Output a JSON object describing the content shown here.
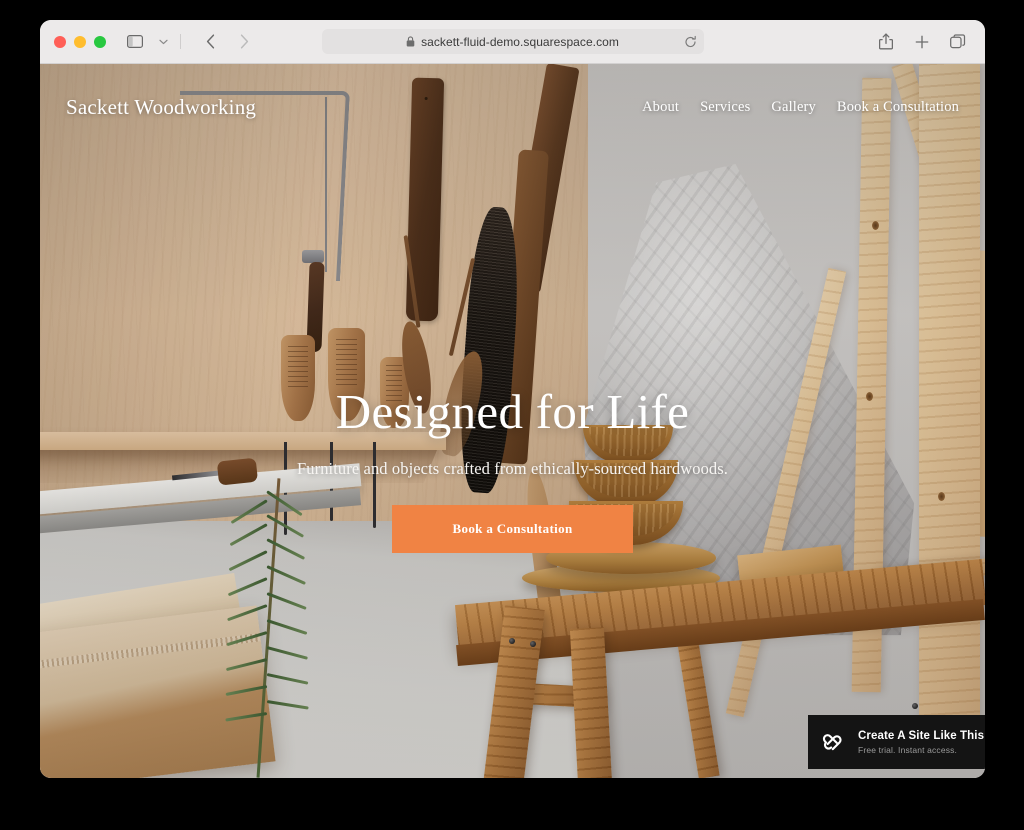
{
  "browser": {
    "traffic_lights": [
      {
        "name": "close",
        "color": "#ff5f57"
      },
      {
        "name": "minimize",
        "color": "#ffbd2e"
      },
      {
        "name": "zoom",
        "color": "#28c840"
      }
    ],
    "sidebar_toggle_label": "Show Sidebar",
    "sidebar_menu_label": "Sidebar Options",
    "back_label": "Back",
    "forward_label": "Forward",
    "address": {
      "url": "sackett-fluid-demo.squarespace.com",
      "lock_icon": "lock-icon",
      "reload_label": "Reload"
    },
    "actions": [
      {
        "name": "share-icon",
        "label": "Share"
      },
      {
        "name": "new-tab-icon",
        "label": "New Tab"
      },
      {
        "name": "tab-overview-icon",
        "label": "Tab Overview"
      }
    ]
  },
  "site": {
    "logo": "Sackett Woodworking",
    "nav": [
      {
        "label": "About"
      },
      {
        "label": "Services"
      },
      {
        "label": "Gallery"
      },
      {
        "label": "Book a Consultation"
      }
    ],
    "hero": {
      "title": "Designed for Life",
      "subtitle": "Furniture and objects crafted from ethically-sourced hardwoods.",
      "cta_label": "Book a Consultation",
      "cta_color": "#f08344"
    }
  },
  "promo_badge": {
    "logo_name": "squarespace-logo",
    "title": "Create A Site Like This",
    "subtitle": "Free trial. Instant access.",
    "background": "#141414"
  }
}
